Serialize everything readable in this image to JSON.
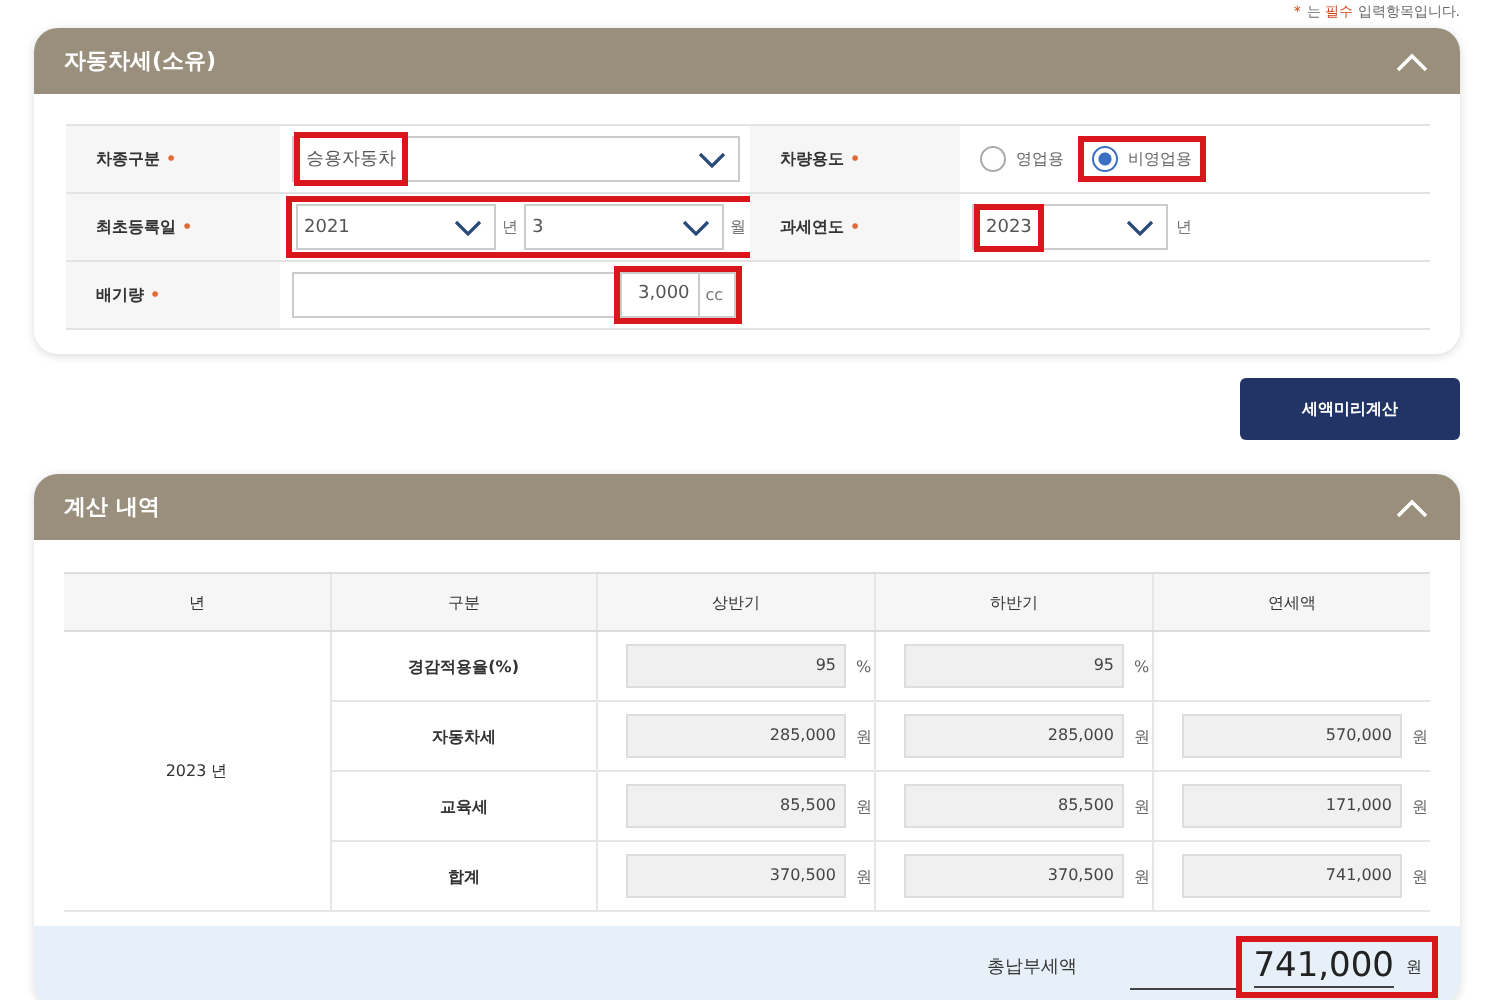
{
  "note": {
    "star": "*",
    "prefix": "는",
    "highlight": "필수",
    "suffix": "입력항목입니다."
  },
  "vehicle_section": {
    "title": "자동차세(소유)",
    "rows": [
      {
        "cells": [
          {
            "label": "차종구분",
            "required_mark": "•",
            "kind": "select",
            "value": "승용자동차",
            "highlighted": true
          },
          {
            "label": "차량용도",
            "required_mark": "•",
            "kind": "radio",
            "options": [
              {
                "label": "영업용",
                "selected": false,
                "highlighted": false
              },
              {
                "label": "비영업용",
                "selected": true,
                "highlighted": true
              }
            ]
          }
        ]
      },
      {
        "cells": [
          {
            "label": "최초등록일",
            "required_mark": "•",
            "kind": "date",
            "highlighted": true,
            "parts": [
              {
                "value": "2021",
                "unit": "년"
              },
              {
                "value": "3",
                "unit": "월"
              }
            ]
          },
          {
            "label": "과세연도",
            "required_mark": "•",
            "kind": "year",
            "value": "2023",
            "unit": "년",
            "highlighted": true
          }
        ]
      },
      {
        "cells": [
          {
            "label": "배기량",
            "required_mark": "•",
            "kind": "input",
            "value": "3,000",
            "unit": "cc",
            "highlighted": true
          }
        ]
      }
    ]
  },
  "calc_button": "세액미리계산",
  "result_section": {
    "title": "계산 내역",
    "columns": [
      "년",
      "구분",
      "상반기",
      "하반기",
      "연세액"
    ],
    "rows": [
      {
        "cells": [
          {
            "text": "2023 년",
            "rowspan": 4
          },
          "경감적용율(%)",
          {
            "value": "95",
            "unit": "%"
          },
          {
            "value": "95",
            "unit": "%"
          },
          ""
        ]
      },
      {
        "cells": [
          "자동차세",
          {
            "value": "285,000",
            "unit": "원"
          },
          {
            "value": "285,000",
            "unit": "원"
          },
          {
            "value": "570,000",
            "unit": "원"
          }
        ]
      },
      {
        "cells": [
          "교육세",
          {
            "value": "85,500",
            "unit": "원"
          },
          {
            "value": "85,500",
            "unit": "원"
          },
          {
            "value": "171,000",
            "unit": "원"
          }
        ]
      },
      {
        "cells": [
          "합계",
          {
            "value": "370,500",
            "unit": "원"
          },
          {
            "value": "370,500",
            "unit": "원"
          },
          {
            "value": "741,000",
            "unit": "원"
          }
        ]
      }
    ],
    "total": {
      "label": "총납부세액",
      "value": "741,000",
      "unit": "원",
      "highlighted": true
    }
  }
}
